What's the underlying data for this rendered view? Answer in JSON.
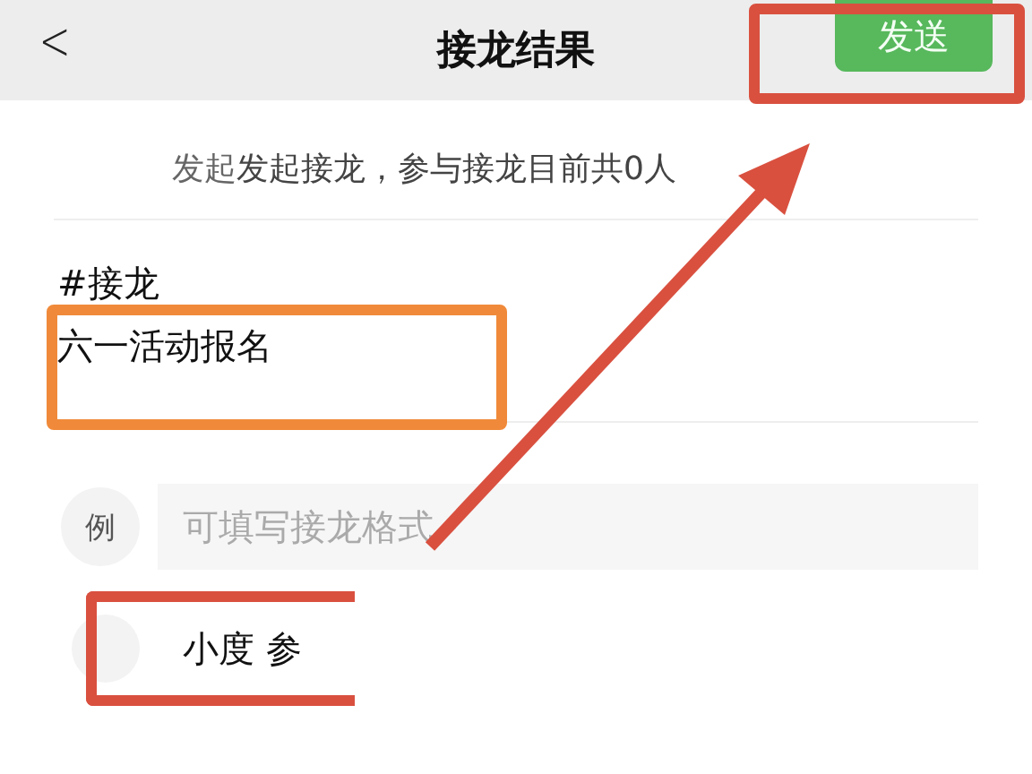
{
  "header": {
    "back_icon": "<",
    "title": "接龙结果",
    "send_button": "发送"
  },
  "info": {
    "blurred_prefix": "发起",
    "text": "发起接龙，参与接龙目前共0人"
  },
  "topic": {
    "tag": "#接龙",
    "title": "六一活动报名"
  },
  "example": {
    "badge": "例",
    "placeholder": "可填写接龙格式"
  },
  "entries": [
    {
      "text": "小度 参"
    }
  ],
  "annotations": [
    {
      "kind": "box",
      "color": "#d9503f"
    },
    {
      "kind": "box",
      "color": "#f08a3a"
    },
    {
      "kind": "box",
      "color": "#d9503f"
    },
    {
      "kind": "arrow",
      "color": "#d9503f"
    }
  ]
}
